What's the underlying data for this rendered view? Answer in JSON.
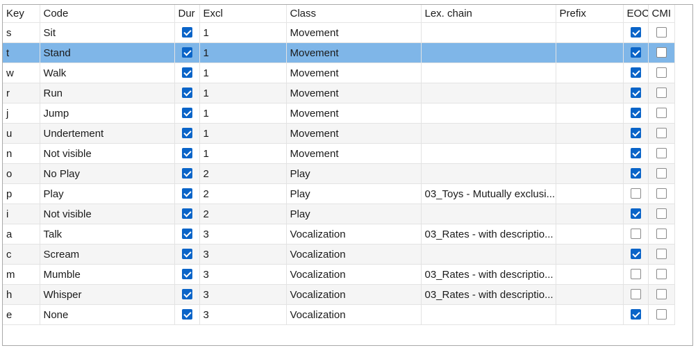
{
  "columns": [
    "Key",
    "Code",
    "Dur",
    "Excl",
    "Class",
    "Lex. chain",
    "Prefix",
    "EOC",
    "CMI"
  ],
  "selected_row": 1,
  "colors": {
    "selection": "#7fb6e8",
    "checkbox_on": "#0a64c8",
    "alt_row": "#f5f5f5"
  },
  "rows": [
    {
      "key": "s",
      "code": "Sit",
      "dur": true,
      "excl": "1",
      "class": "Movement",
      "lex": "",
      "prefix": "",
      "eoc": true,
      "cmt": false
    },
    {
      "key": "t",
      "code": "Stand",
      "dur": true,
      "excl": "1",
      "class": "Movement",
      "lex": "",
      "prefix": "",
      "eoc": true,
      "cmt": false
    },
    {
      "key": "w",
      "code": "Walk",
      "dur": true,
      "excl": "1",
      "class": "Movement",
      "lex": "",
      "prefix": "",
      "eoc": true,
      "cmt": false
    },
    {
      "key": "r",
      "code": "Run",
      "dur": true,
      "excl": "1",
      "class": "Movement",
      "lex": "",
      "prefix": "",
      "eoc": true,
      "cmt": false
    },
    {
      "key": "j",
      "code": "Jump",
      "dur": true,
      "excl": "1",
      "class": "Movement",
      "lex": "",
      "prefix": "",
      "eoc": true,
      "cmt": false
    },
    {
      "key": "u",
      "code": "Undertement",
      "dur": true,
      "excl": "1",
      "class": "Movement",
      "lex": "",
      "prefix": "",
      "eoc": true,
      "cmt": false
    },
    {
      "key": "n",
      "code": "Not visible",
      "dur": true,
      "excl": "1",
      "class": "Movement",
      "lex": "",
      "prefix": "",
      "eoc": true,
      "cmt": false
    },
    {
      "key": "o",
      "code": "No Play",
      "dur": true,
      "excl": "2",
      "class": "Play",
      "lex": "",
      "prefix": "",
      "eoc": true,
      "cmt": false
    },
    {
      "key": "p",
      "code": "Play",
      "dur": true,
      "excl": "2",
      "class": "Play",
      "lex": "03_Toys - Mutually exclusi...",
      "prefix": "",
      "eoc": false,
      "cmt": false
    },
    {
      "key": "i",
      "code": "Not visible",
      "dur": true,
      "excl": "2",
      "class": "Play",
      "lex": "",
      "prefix": "",
      "eoc": true,
      "cmt": false
    },
    {
      "key": "a",
      "code": "Talk",
      "dur": true,
      "excl": "3",
      "class": "Vocalization",
      "lex": "03_Rates - with descriptio...",
      "prefix": "",
      "eoc": false,
      "cmt": false
    },
    {
      "key": "c",
      "code": "Scream",
      "dur": true,
      "excl": "3",
      "class": "Vocalization",
      "lex": "",
      "prefix": "",
      "eoc": true,
      "cmt": false
    },
    {
      "key": "m",
      "code": "Mumble",
      "dur": true,
      "excl": "3",
      "class": "Vocalization",
      "lex": "03_Rates - with descriptio...",
      "prefix": "",
      "eoc": false,
      "cmt": false
    },
    {
      "key": "h",
      "code": "Whisper",
      "dur": true,
      "excl": "3",
      "class": "Vocalization",
      "lex": "03_Rates - with descriptio...",
      "prefix": "",
      "eoc": false,
      "cmt": false
    },
    {
      "key": "e",
      "code": "None",
      "dur": true,
      "excl": "3",
      "class": "Vocalization",
      "lex": "",
      "prefix": "",
      "eoc": true,
      "cmt": false
    }
  ]
}
